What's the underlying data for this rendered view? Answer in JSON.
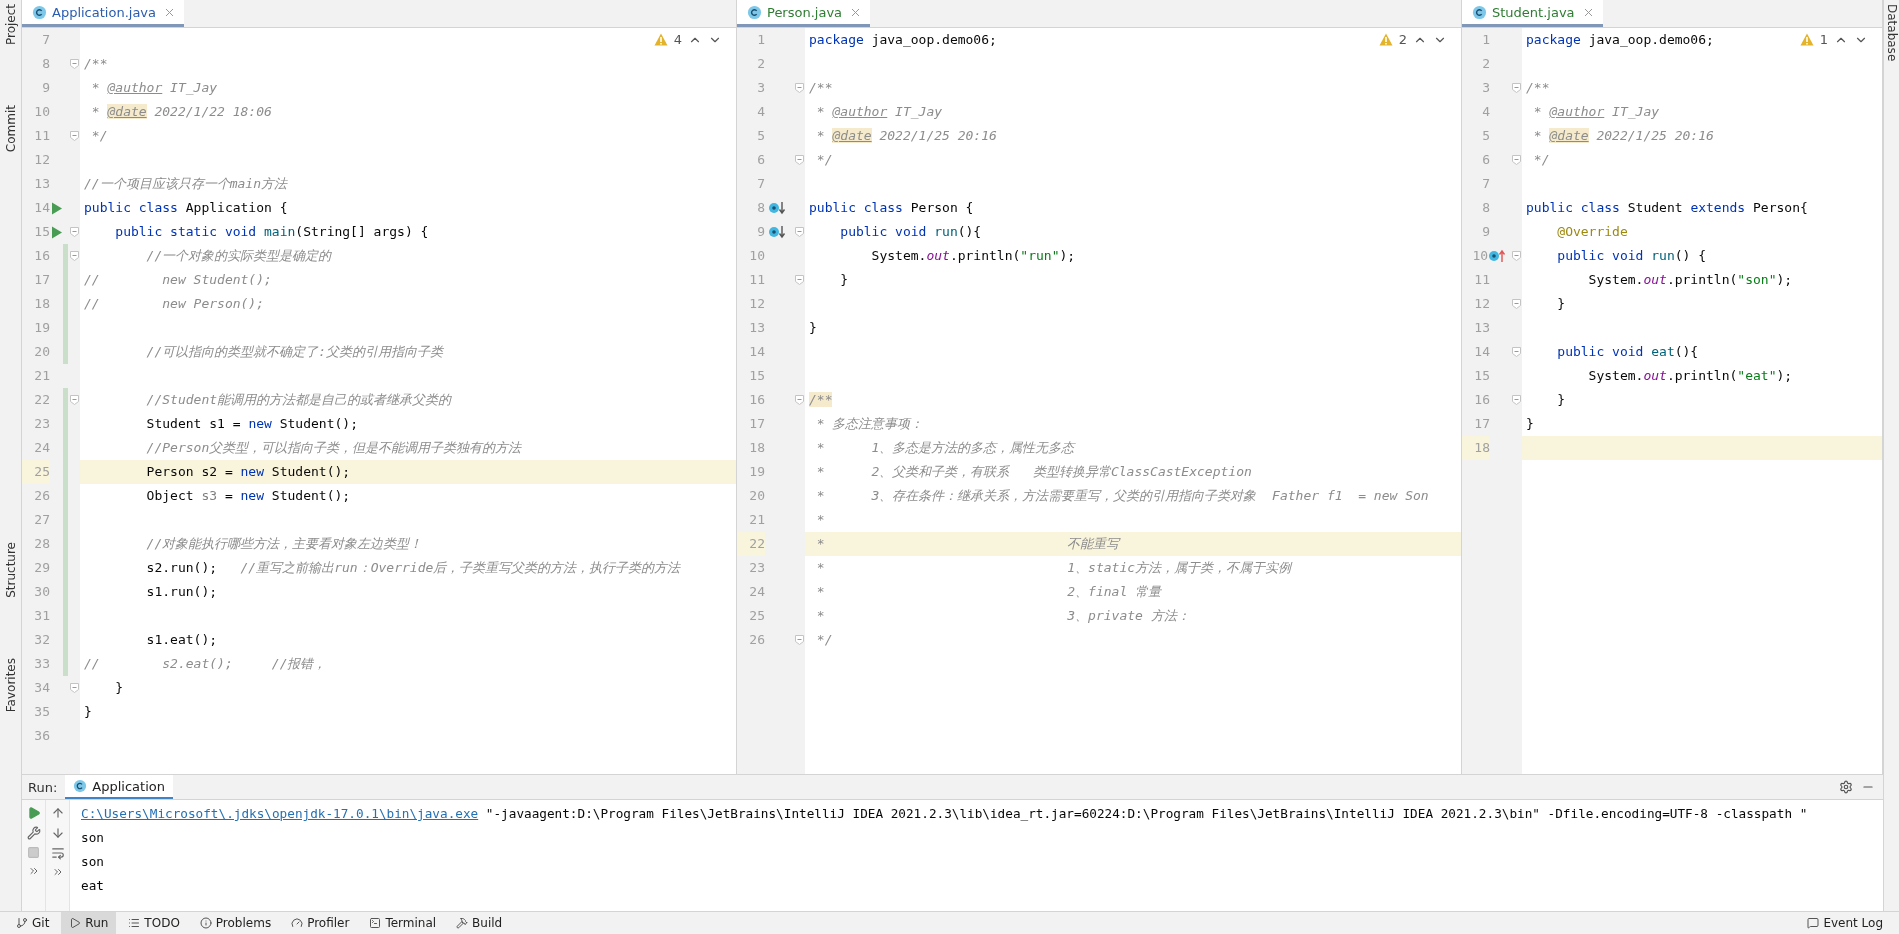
{
  "side_strip": {
    "left": [
      "Project",
      "Commit",
      "Structure",
      "Favorites"
    ],
    "right": [
      "Database"
    ]
  },
  "editors": [
    {
      "tab": {
        "label": "Application.java",
        "selected": true,
        "color": "#2a5db0"
      },
      "warnings": "4",
      "lines": [
        {
          "number": "7",
          "fold": false,
          "changed": false,
          "current": false
        },
        {
          "number": "8",
          "fold": true,
          "changed": false,
          "current": false,
          "tokens": [
            {
              "kind": "comment",
              "text": "/**"
            }
          ]
        },
        {
          "number": "9",
          "fold": false,
          "changed": false,
          "current": false,
          "tokens": [
            {
              "kind": "comment",
              "text": " * "
            },
            {
              "kind": "doc-tag",
              "text": "@author"
            },
            {
              "kind": "comment",
              "text": " IT_Jay"
            }
          ]
        },
        {
          "number": "10",
          "fold": false,
          "changed": false,
          "current": false,
          "tokens": [
            {
              "kind": "comment",
              "text": " * "
            },
            {
              "kind": "doc-tag-marked",
              "text": "@date"
            },
            {
              "kind": "comment",
              "text": " 2022/1/22 18:06"
            }
          ]
        },
        {
          "number": "11",
          "fold": true,
          "changed": false,
          "current": false,
          "tokens": [
            {
              "kind": "comment",
              "text": " */"
            }
          ]
        },
        {
          "number": "12",
          "fold": false,
          "changed": false,
          "current": false
        },
        {
          "number": "13",
          "fold": false,
          "changed": false,
          "current": false,
          "tokens": [
            {
              "kind": "comment",
              "text": "//一个项目应该只存一个main方法"
            }
          ]
        },
        {
          "number": "14",
          "gutter_icon": {
            "kind": "run"
          },
          "fold": false,
          "changed": false,
          "current": false,
          "tokens": [
            {
              "kind": "keyword",
              "text": "public class "
            },
            {
              "kind": "plain",
              "text": "Application {"
            }
          ]
        },
        {
          "number": "15",
          "gutter_icon": {
            "kind": "run"
          },
          "fold": true,
          "changed": false,
          "current": false,
          "tokens": [
            {
              "kind": "keyword",
              "text": "    public static void "
            },
            {
              "kind": "method",
              "text": "main"
            },
            {
              "kind": "plain",
              "text": "(String[] args) {"
            }
          ]
        },
        {
          "number": "16",
          "fold": true,
          "changed": true,
          "current": false,
          "tokens": [
            {
              "kind": "comment",
              "text": "        //一个对象的实际类型是确定的"
            }
          ]
        },
        {
          "number": "17",
          "fold": false,
          "changed": true,
          "current": false,
          "tokens": [
            {
              "kind": "comment",
              "text": "//        new Student();"
            }
          ]
        },
        {
          "number": "18",
          "fold": false,
          "changed": true,
          "current": false,
          "tokens": [
            {
              "kind": "comment",
              "text": "//        new Person();"
            }
          ]
        },
        {
          "number": "19",
          "fold": false,
          "changed": true,
          "current": false
        },
        {
          "number": "20",
          "fold": false,
          "changed": true,
          "current": false,
          "tokens": [
            {
              "kind": "comment",
              "text": "        //可以指向的类型就不确定了:父类的引用指向子类"
            }
          ]
        },
        {
          "number": "21",
          "fold": false,
          "changed": false,
          "current": false
        },
        {
          "number": "22",
          "fold": true,
          "changed": true,
          "current": false,
          "tokens": [
            {
              "kind": "comment",
              "text": "        //Student能调用的方法都是自己的或者继承父类的"
            }
          ]
        },
        {
          "number": "23",
          "fold": false,
          "changed": true,
          "current": false,
          "tokens": [
            {
              "kind": "plain",
              "text": "        Student s1 = "
            },
            {
              "kind": "keyword",
              "text": "new"
            },
            {
              "kind": "plain",
              "text": " Student();"
            }
          ]
        },
        {
          "number": "24",
          "fold": false,
          "changed": true,
          "current": false,
          "tokens": [
            {
              "kind": "comment",
              "text": "        //Person父类型，可以指向子类，但是不能调用子类独有的方法"
            }
          ]
        },
        {
          "number": "25",
          "fold": false,
          "changed": true,
          "current": true,
          "tokens": [
            {
              "kind": "plain",
              "text": "        Person s2 = "
            },
            {
              "kind": "keyword",
              "text": "new"
            },
            {
              "kind": "plain",
              "text": " Student();"
            }
          ]
        },
        {
          "number": "26",
          "fold": false,
          "changed": true,
          "current": false,
          "tokens": [
            {
              "kind": "plain",
              "text": "        Object "
            },
            {
              "kind": "unused",
              "text": "s3"
            },
            {
              "kind": "plain",
              "text": " = "
            },
            {
              "kind": "keyword",
              "text": "new"
            },
            {
              "kind": "plain",
              "text": " Student();"
            }
          ]
        },
        {
          "number": "27",
          "fold": false,
          "changed": true,
          "current": false
        },
        {
          "number": "28",
          "fold": false,
          "changed": true,
          "current": false,
          "tokens": [
            {
              "kind": "comment",
              "text": "        //对象能执行哪些方法，主要看对象左边类型！"
            }
          ]
        },
        {
          "number": "29",
          "fold": false,
          "changed": true,
          "current": false,
          "tokens": [
            {
              "kind": "plain",
              "text": "        s2.run();   "
            },
            {
              "kind": "comment",
              "text": "//重写之前输出run：Override后，子类重写父类的方法，执行子类的方法"
            }
          ]
        },
        {
          "number": "30",
          "fold": false,
          "changed": true,
          "current": false,
          "tokens": [
            {
              "kind": "plain",
              "text": "        s1.run();"
            }
          ]
        },
        {
          "number": "31",
          "fold": false,
          "changed": true,
          "current": false
        },
        {
          "number": "32",
          "fold": false,
          "changed": true,
          "current": false,
          "tokens": [
            {
              "kind": "plain",
              "text": "        s1.eat();"
            }
          ]
        },
        {
          "number": "33",
          "fold": false,
          "changed": true,
          "current": false,
          "tokens": [
            {
              "kind": "comment",
              "text": "//        s2.eat();     //报错，"
            }
          ]
        },
        {
          "number": "34",
          "fold": true,
          "changed": false,
          "current": false,
          "tokens": [
            {
              "kind": "plain",
              "text": "    }"
            }
          ]
        },
        {
          "number": "35",
          "fold": false,
          "changed": false,
          "current": false,
          "tokens": [
            {
              "kind": "plain",
              "text": "}"
            }
          ]
        },
        {
          "number": "36",
          "fold": false,
          "changed": false,
          "current": false
        }
      ]
    },
    {
      "tab": {
        "label": "Person.java",
        "selected": true,
        "color": "#2e7d32"
      },
      "warnings": "2",
      "lines": [
        {
          "number": "1",
          "fold": false,
          "changed": false,
          "current": false,
          "tokens": [
            {
              "kind": "keyword",
              "text": "package "
            },
            {
              "kind": "plain",
              "text": "java_oop.demo06;"
            }
          ]
        },
        {
          "number": "2",
          "fold": false,
          "changed": false,
          "current": false
        },
        {
          "number": "3",
          "fold": true,
          "changed": false,
          "current": false,
          "tokens": [
            {
              "kind": "comment",
              "text": "/**"
            }
          ]
        },
        {
          "number": "4",
          "fold": false,
          "changed": false,
          "current": false,
          "tokens": [
            {
              "kind": "comment",
              "text": " * "
            },
            {
              "kind": "doc-tag",
              "text": "@author"
            },
            {
              "kind": "comment",
              "text": " IT_Jay"
            }
          ]
        },
        {
          "number": "5",
          "fold": false,
          "changed": false,
          "current": false,
          "tokens": [
            {
              "kind": "comment",
              "text": " * "
            },
            {
              "kind": "doc-tag-marked",
              "text": "@date"
            },
            {
              "kind": "comment",
              "text": " 2022/1/25 20:16"
            }
          ]
        },
        {
          "number": "6",
          "fold": true,
          "changed": false,
          "current": false,
          "tokens": [
            {
              "kind": "comment",
              "text": " */"
            }
          ]
        },
        {
          "number": "7",
          "fold": false,
          "changed": false,
          "current": false
        },
        {
          "number": "8",
          "gutter_icon": {
            "kind": "implemented"
          },
          "fold": false,
          "changed": false,
          "current": false,
          "tokens": [
            {
              "kind": "keyword",
              "text": "public class "
            },
            {
              "kind": "plain",
              "text": "Person {"
            }
          ]
        },
        {
          "number": "9",
          "gutter_icon": {
            "kind": "implemented"
          },
          "fold": true,
          "changed": false,
          "current": false,
          "tokens": [
            {
              "kind": "keyword",
              "text": "    public void "
            },
            {
              "kind": "method",
              "text": "run"
            },
            {
              "kind": "plain",
              "text": "(){"
            }
          ]
        },
        {
          "number": "10",
          "fold": false,
          "changed": false,
          "current": false,
          "tokens": [
            {
              "kind": "plain",
              "text": "        System."
            },
            {
              "kind": "field",
              "text": "out"
            },
            {
              "kind": "plain",
              "text": ".println("
            },
            {
              "kind": "string",
              "text": "\"run\""
            },
            {
              "kind": "plain",
              "text": ");"
            }
          ]
        },
        {
          "number": "11",
          "fold": true,
          "changed": false,
          "current": false,
          "tokens": [
            {
              "kind": "plain",
              "text": "    }"
            }
          ]
        },
        {
          "number": "12",
          "fold": false,
          "changed": false,
          "current": false
        },
        {
          "number": "13",
          "fold": false,
          "changed": false,
          "current": false,
          "tokens": [
            {
              "kind": "plain",
              "text": "}"
            }
          ]
        },
        {
          "number": "14",
          "fold": false,
          "changed": false,
          "current": false
        },
        {
          "number": "15",
          "fold": false,
          "changed": false,
          "current": false
        },
        {
          "number": "16",
          "fold": true,
          "changed": false,
          "current": false,
          "tokens": [
            {
              "kind": "comment-marked",
              "text": "/**"
            }
          ]
        },
        {
          "number": "17",
          "fold": false,
          "changed": false,
          "current": false,
          "tokens": [
            {
              "kind": "comment",
              "text": " * 多态注意事项："
            }
          ]
        },
        {
          "number": "18",
          "fold": false,
          "changed": false,
          "current": false,
          "tokens": [
            {
              "kind": "comment",
              "text": " *      1、多态是方法的多态，属性无多态"
            }
          ]
        },
        {
          "number": "19",
          "fold": false,
          "changed": false,
          "current": false,
          "tokens": [
            {
              "kind": "comment",
              "text": " *      2、父类和子类，有联系   类型转换异常ClassCastException"
            }
          ]
        },
        {
          "number": "20",
          "fold": false,
          "changed": false,
          "current": false,
          "tokens": [
            {
              "kind": "comment",
              "text": " *      3、存在条件：继承关系，方法需要重写，父类的引用指向子类对象  Father f1  = new Son"
            }
          ]
        },
        {
          "number": "21",
          "fold": false,
          "changed": false,
          "current": false,
          "tokens": [
            {
              "kind": "comment",
              "text": " *"
            }
          ]
        },
        {
          "number": "22",
          "fold": false,
          "changed": false,
          "current": true,
          "tokens": [
            {
              "kind": "comment",
              "text": " *                               不能重写"
            }
          ]
        },
        {
          "number": "23",
          "fold": false,
          "changed": false,
          "current": false,
          "tokens": [
            {
              "kind": "comment",
              "text": " *                               1、static方法，属于类，不属于实例"
            }
          ]
        },
        {
          "number": "24",
          "fold": false,
          "changed": false,
          "current": false,
          "tokens": [
            {
              "kind": "comment",
              "text": " *                               2、final 常量"
            }
          ]
        },
        {
          "number": "25",
          "fold": false,
          "changed": false,
          "current": false,
          "tokens": [
            {
              "kind": "comment",
              "text": " *                               3、private 方法："
            }
          ]
        },
        {
          "number": "26",
          "fold": true,
          "changed": false,
          "current": false,
          "tokens": [
            {
              "kind": "comment",
              "text": " */"
            }
          ]
        }
      ]
    },
    {
      "tab": {
        "label": "Student.java",
        "selected": true,
        "color": "#2e7d32"
      },
      "warnings": "1",
      "lines": [
        {
          "number": "1",
          "fold": false,
          "changed": false,
          "current": false,
          "tokens": [
            {
              "kind": "keyword",
              "text": "package "
            },
            {
              "kind": "plain",
              "text": "java_oop.demo06;"
            }
          ]
        },
        {
          "number": "2",
          "fold": false,
          "changed": false,
          "current": false
        },
        {
          "number": "3",
          "fold": true,
          "changed": false,
          "current": false,
          "tokens": [
            {
              "kind": "comment",
              "text": "/**"
            }
          ]
        },
        {
          "number": "4",
          "fold": false,
          "changed": false,
          "current": false,
          "tokens": [
            {
              "kind": "comment",
              "text": " * "
            },
            {
              "kind": "doc-tag",
              "text": "@author"
            },
            {
              "kind": "comment",
              "text": " IT_Jay"
            }
          ]
        },
        {
          "number": "5",
          "fold": false,
          "changed": false,
          "current": false,
          "tokens": [
            {
              "kind": "comment",
              "text": " * "
            },
            {
              "kind": "doc-tag-marked",
              "text": "@date"
            },
            {
              "kind": "comment",
              "text": " 2022/1/25 20:16"
            }
          ]
        },
        {
          "number": "6",
          "fold": true,
          "changed": false,
          "current": false,
          "tokens": [
            {
              "kind": "comment",
              "text": " */"
            }
          ]
        },
        {
          "number": "7",
          "fold": false,
          "changed": false,
          "current": false
        },
        {
          "number": "8",
          "fold": false,
          "changed": false,
          "current": false,
          "tokens": [
            {
              "kind": "keyword",
              "text": "public class "
            },
            {
              "kind": "plain",
              "text": "Student "
            },
            {
              "kind": "keyword",
              "text": "extends "
            },
            {
              "kind": "plain",
              "text": "Person{"
            }
          ]
        },
        {
          "number": "9",
          "fold": false,
          "changed": false,
          "current": false,
          "tokens": [
            {
              "kind": "annotation",
              "text": "    @Override"
            }
          ]
        },
        {
          "number": "10",
          "gutter_icon": {
            "kind": "overrides"
          },
          "fold": true,
          "changed": false,
          "current": false,
          "tokens": [
            {
              "kind": "keyword",
              "text": "    public void "
            },
            {
              "kind": "method",
              "text": "run"
            },
            {
              "kind": "plain",
              "text": "() {"
            }
          ]
        },
        {
          "number": "11",
          "fold": false,
          "changed": false,
          "current": false,
          "tokens": [
            {
              "kind": "plain",
              "text": "        System."
            },
            {
              "kind": "field",
              "text": "out"
            },
            {
              "kind": "plain",
              "text": ".println("
            },
            {
              "kind": "string",
              "text": "\"son\""
            },
            {
              "kind": "plain",
              "text": ");"
            }
          ]
        },
        {
          "number": "12",
          "fold": true,
          "changed": false,
          "current": false,
          "tokens": [
            {
              "kind": "plain",
              "text": "    }"
            }
          ]
        },
        {
          "number": "13",
          "fold": false,
          "changed": false,
          "current": false
        },
        {
          "number": "14",
          "fold": true,
          "changed": false,
          "current": false,
          "tokens": [
            {
              "kind": "keyword",
              "text": "    public void "
            },
            {
              "kind": "method",
              "text": "eat"
            },
            {
              "kind": "plain",
              "text": "(){"
            }
          ]
        },
        {
          "number": "15",
          "fold": false,
          "changed": false,
          "current": false,
          "tokens": [
            {
              "kind": "plain",
              "text": "        System."
            },
            {
              "kind": "field",
              "text": "out"
            },
            {
              "kind": "plain",
              "text": ".println("
            },
            {
              "kind": "string",
              "text": "\"eat\""
            },
            {
              "kind": "plain",
              "text": ");"
            }
          ]
        },
        {
          "number": "16",
          "fold": true,
          "changed": false,
          "current": false,
          "tokens": [
            {
              "kind": "plain",
              "text": "    }"
            }
          ]
        },
        {
          "number": "17",
          "fold": false,
          "changed": false,
          "current": false,
          "tokens": [
            {
              "kind": "plain",
              "text": "}"
            }
          ]
        },
        {
          "number": "18",
          "fold": false,
          "changed": false,
          "current": true
        }
      ]
    }
  ],
  "run": {
    "label": "Run:",
    "tabs": [
      {
        "label": "Application",
        "selected": true
      }
    ],
    "output": [
      {
        "kind": "command",
        "link": "C:\\Users\\Microsoft\\.jdks\\openjdk-17.0.1\\bin\\java.exe",
        "text": " \"-javaagent:D:\\Program Files\\JetBrains\\IntelliJ IDEA 2021.2.3\\lib\\idea_rt.jar=60224:D:\\Program Files\\JetBrains\\IntelliJ IDEA 2021.2.3\\bin\" -Dfile.encoding=UTF-8 -classpath \""
      },
      {
        "kind": "plain",
        "text": "son"
      },
      {
        "kind": "plain",
        "text": "son"
      },
      {
        "kind": "plain",
        "text": "eat"
      }
    ]
  },
  "status_bar": {
    "tools": [
      {
        "label": "Git",
        "selected": false
      },
      {
        "label": "Run",
        "selected": true
      },
      {
        "label": "TODO",
        "selected": false
      },
      {
        "label": "Problems",
        "selected": false
      },
      {
        "label": "Profiler",
        "selected": false
      },
      {
        "label": "Terminal",
        "selected": false
      },
      {
        "label": "Build",
        "selected": false
      }
    ],
    "event_log": "Event Log"
  }
}
